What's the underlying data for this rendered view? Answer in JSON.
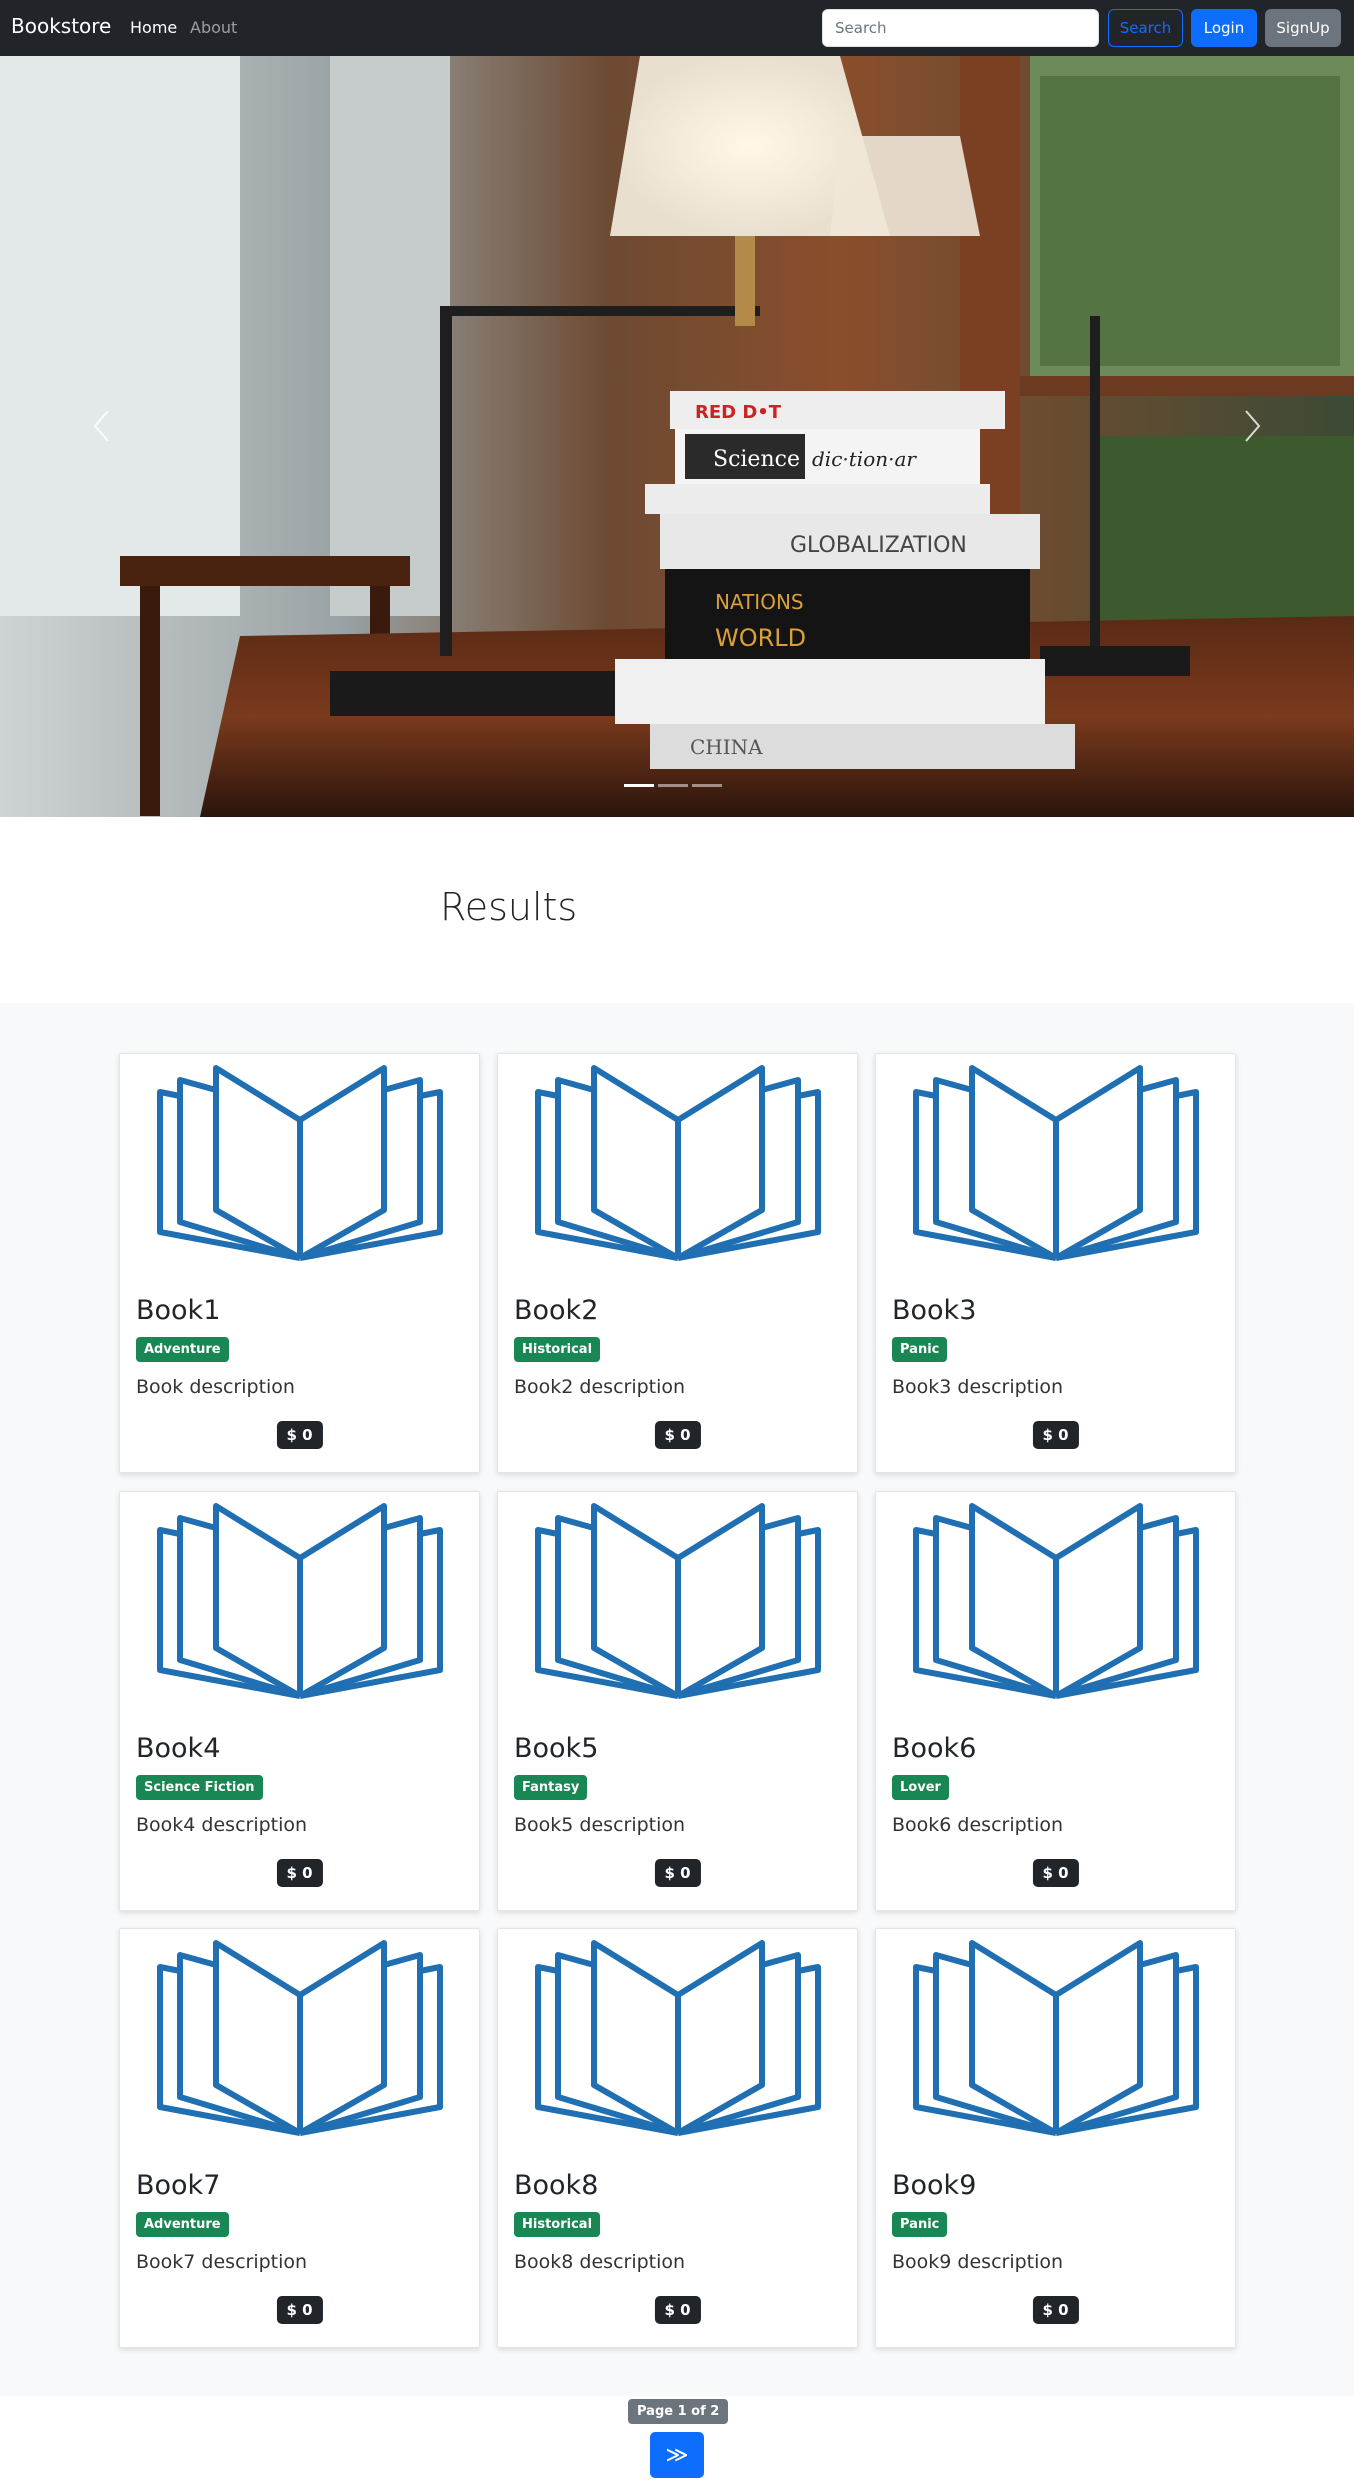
{
  "navbar": {
    "brand": "Bookstore",
    "links": [
      {
        "label": "Home",
        "active": true
      },
      {
        "label": "About",
        "active": false
      }
    ],
    "search": {
      "placeholder": "Search",
      "value": ""
    },
    "search_label": "Search",
    "login_label": "Login",
    "signup_label": "SignUp"
  },
  "carousel": {
    "prev_icon": "chevron-left-icon",
    "next_icon": "chevron-right-icon",
    "slide_count": 3,
    "active_slide": 1
  },
  "results": {
    "title": "Results",
    "cards": [
      {
        "title": "Book1",
        "genre": "Adventure",
        "description": "Book description",
        "price": "$ 0"
      },
      {
        "title": "Book2",
        "genre": "Historical",
        "description": "Book2 description",
        "price": "$ 0"
      },
      {
        "title": "Book3",
        "genre": "Panic",
        "description": "Book3 description",
        "price": "$ 0"
      },
      {
        "title": "Book4",
        "genre": "Science Fiction",
        "description": "Book4 description",
        "price": "$ 0"
      },
      {
        "title": "Book5",
        "genre": "Fantasy",
        "description": "Book5 description",
        "price": "$ 0"
      },
      {
        "title": "Book6",
        "genre": "Lover",
        "description": "Book6 description",
        "price": "$ 0"
      },
      {
        "title": "Book7",
        "genre": "Adventure",
        "description": "Book7 description",
        "price": "$ 0"
      },
      {
        "title": "Book8",
        "genre": "Historical",
        "description": "Book8 description",
        "price": "$ 0"
      },
      {
        "title": "Book9",
        "genre": "Panic",
        "description": "Book9 description",
        "price": "$ 0"
      }
    ]
  },
  "pagination": {
    "page_label": "Page 1 of 2",
    "next_label": "≫"
  },
  "colors": {
    "navbar_bg": "#212529",
    "primary": "#0d6efd",
    "secondary": "#6c757d",
    "badge_success": "#198754",
    "book_icon": "#1f6fb2"
  }
}
